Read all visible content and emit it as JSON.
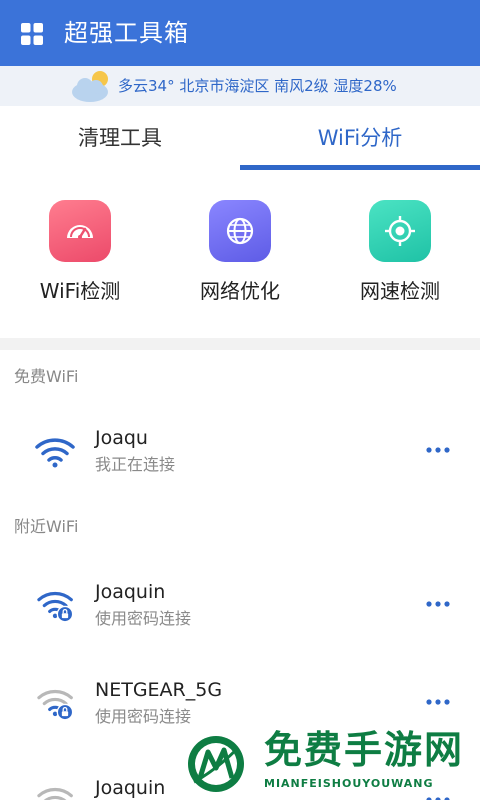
{
  "header": {
    "title": "超强工具箱",
    "menu_icon": "grid-icon"
  },
  "weather": {
    "text": "多云34° 北京市海淀区 南风2级 湿度28%",
    "icon": "partly-cloudy-icon"
  },
  "tabs": [
    {
      "label": "清理工具",
      "active": false
    },
    {
      "label": "WiFi分析",
      "active": true
    }
  ],
  "tools": [
    {
      "label": "WiFi检测",
      "icon": "speedometer-icon",
      "color": "#f05d78"
    },
    {
      "label": "网络优化",
      "icon": "globe-icon",
      "color": "#6f6ef0"
    },
    {
      "label": "网速检测",
      "icon": "target-icon",
      "color": "#2fd3b5"
    }
  ],
  "free_wifi": {
    "title": "免费WiFi",
    "items": [
      {
        "name": "Joaqu",
        "status": "我正在连接",
        "locked": false
      }
    ]
  },
  "nearby_wifi": {
    "title": "附近WiFi",
    "items": [
      {
        "name": "Joaquin",
        "status": "使用密码连接",
        "locked": true
      },
      {
        "name": "NETGEAR_5G",
        "status": "使用密码连接",
        "locked": true
      },
      {
        "name": "Joaquin",
        "status": "",
        "locked": true
      }
    ]
  },
  "watermark": {
    "text": "免费手游网",
    "sub": "MIANFEISHOUYOUWANG"
  },
  "colors": {
    "primary": "#3b73d9",
    "accent": "#2f67c8",
    "brand_green": "#0e7d43"
  }
}
